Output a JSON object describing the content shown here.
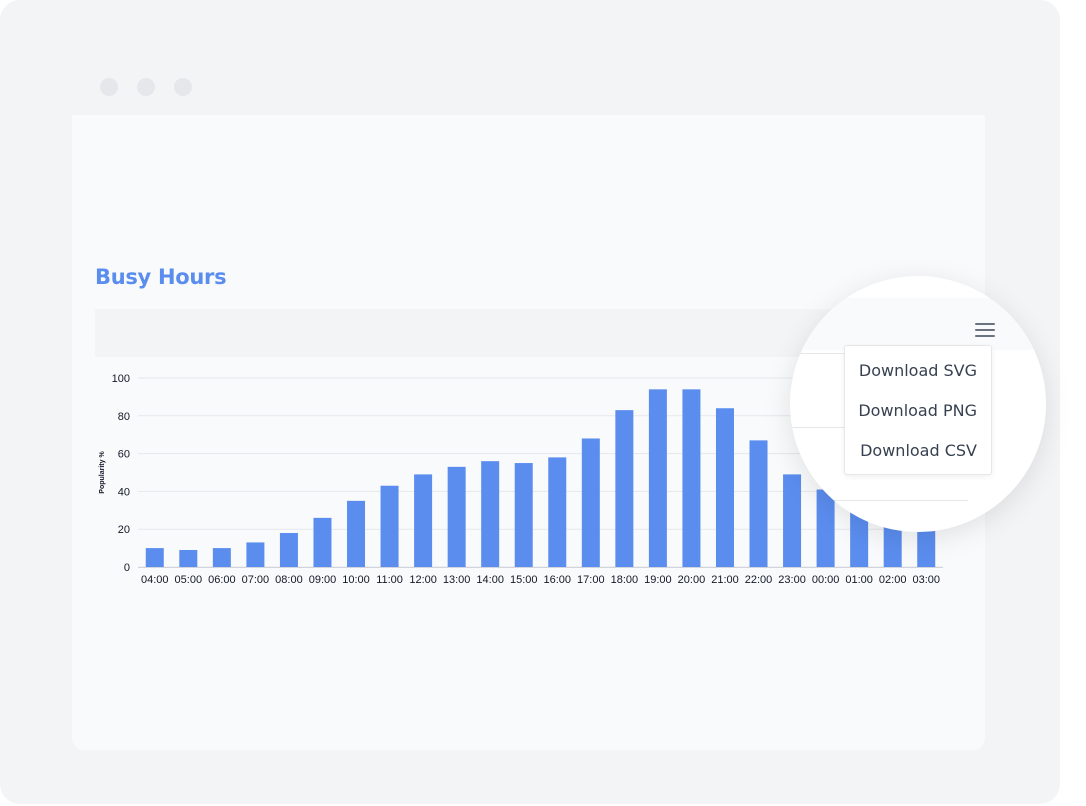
{
  "window": {
    "dots": [
      "window-dot-1",
      "window-dot-2",
      "window-dot-3"
    ]
  },
  "card": {
    "title": "Busy Hours"
  },
  "menu": {
    "items": [
      {
        "label": "Download SVG"
      },
      {
        "label": "Download PNG"
      },
      {
        "label": "Download CSV"
      }
    ]
  },
  "colors": {
    "bar": "#5b8def",
    "title": "#5b8def"
  },
  "chart_data": {
    "type": "bar",
    "ylabel": "Popularity %",
    "xlabel": "",
    "ylim": [
      0,
      100
    ],
    "yticks": [
      0,
      20,
      40,
      60,
      80,
      100
    ],
    "grid": true,
    "categories": [
      "04:00",
      "05:00",
      "06:00",
      "07:00",
      "08:00",
      "09:00",
      "10:00",
      "11:00",
      "12:00",
      "13:00",
      "14:00",
      "15:00",
      "16:00",
      "17:00",
      "18:00",
      "19:00",
      "20:00",
      "21:00",
      "22:00",
      "23:00",
      "00:00",
      "01:00",
      "02:00",
      "03:00"
    ],
    "values": [
      10,
      9,
      10,
      13,
      18,
      26,
      35,
      43,
      49,
      53,
      56,
      55,
      58,
      68,
      83,
      94,
      94,
      84,
      67,
      49,
      41,
      30,
      22,
      19
    ]
  }
}
